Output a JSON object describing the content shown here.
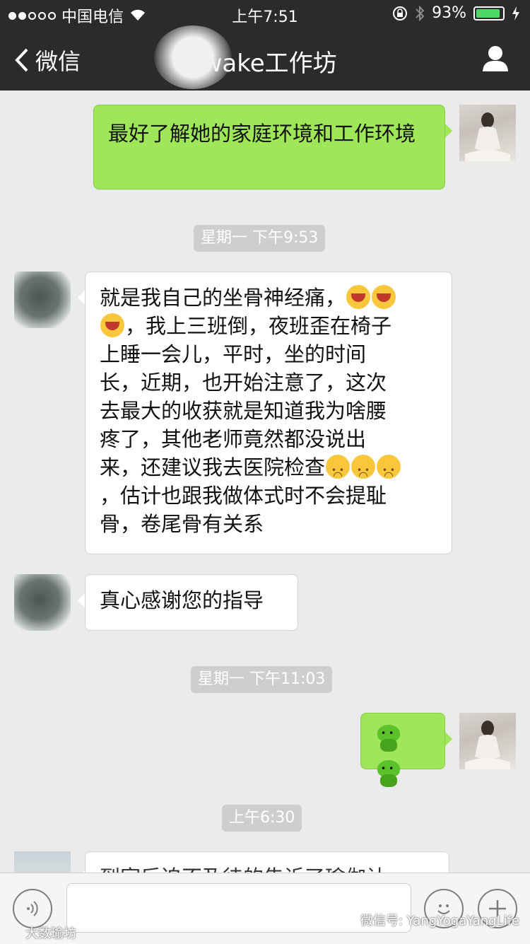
{
  "status_bar": {
    "carrier": "中国电信",
    "time": "上午7:51",
    "battery": "93%",
    "battery_level": 0.93
  },
  "nav": {
    "back_label": "微信",
    "title": "(wake工作坊"
  },
  "messages": [
    {
      "text": "最好了解她的家庭环境和工作环境"
    },
    {
      "stamp": "星期一 下午9:53"
    },
    {
      "lines": [
        "就是我自己的坐骨神经痛，",
        "，我上三班倒，夜班歪在椅子",
        "上睡一会儿，平时，坐的时间",
        "长，近期，也开始注意了，这次",
        "去最大的收获就是知道我为啥腰",
        "疼了，其他老师竟然都没说出",
        "来，还建议我去医院检查",
        "，估计也跟我做体式时不会提耻",
        "骨，卷尾骨有关系"
      ]
    },
    {
      "text": "真心感谢您的指导"
    },
    {
      "stamp": "星期一 下午11:03"
    },
    {
      "stamp": "上午6:30"
    },
    {
      "text": "到家后迫不及待的告诉了瑜伽认"
    }
  ],
  "watermarks": {
    "left": "大数瑜坊",
    "right": "微信号: YangYogaYangLife"
  }
}
